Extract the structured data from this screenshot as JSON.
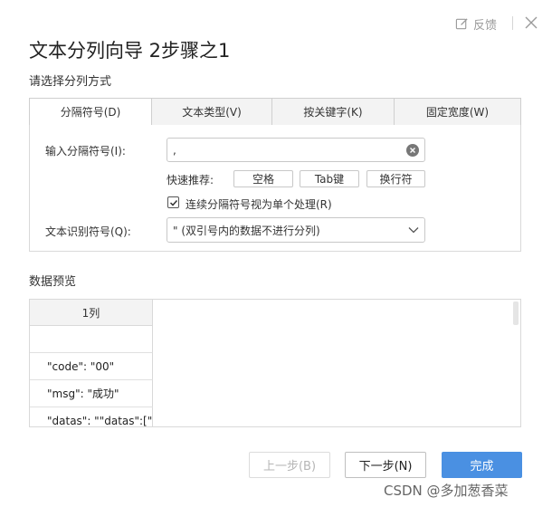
{
  "header": {
    "feedback_label": "反馈"
  },
  "dialog": {
    "title": "文本分列向导 2步骤之1",
    "subtitle": "请选择分列方式"
  },
  "tabs": [
    {
      "label": "分隔符号(D)",
      "active": true
    },
    {
      "label": "文本类型(V)",
      "active": false
    },
    {
      "label": "按关键字(K)",
      "active": false
    },
    {
      "label": "固定宽度(W)",
      "active": false
    }
  ],
  "delimiter": {
    "label": "输入分隔符号(I):",
    "value": ",",
    "quick_label": "快速推荐:",
    "quick_options": [
      "空格",
      "Tab键",
      "换行符"
    ],
    "consecutive_label": "连续分隔符号视为单个处理(R)",
    "consecutive_checked": true
  },
  "qualifier": {
    "label": "文本识别符号(Q):",
    "value": "\"  (双引号内的数据不进行分列)"
  },
  "preview": {
    "title": "数据预览",
    "column_header": "1列",
    "rows": [
      "",
      "\"code\": \"00\"",
      "\"msg\": \"成功\"",
      "\"datas\": \"\"datas\":[\""
    ]
  },
  "buttons": {
    "prev": "上一步(B)",
    "next": "下一步(N)",
    "finish": "完成"
  },
  "watermark": "CSDN @多加葱香菜",
  "colors": {
    "primary": "#4a90e2",
    "border": "#d9d9d9",
    "tab_bg": "#f3f3f3"
  }
}
